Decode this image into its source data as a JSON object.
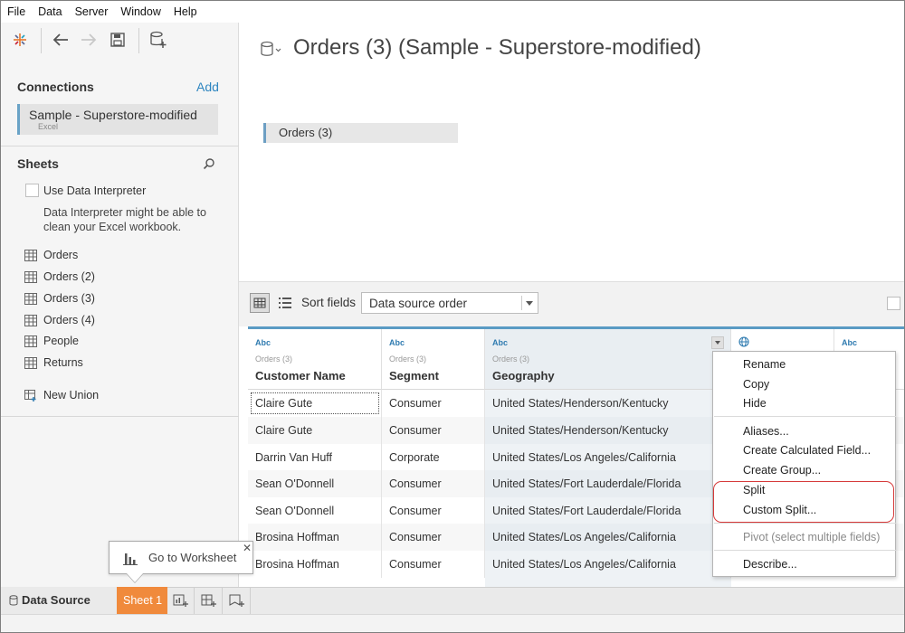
{
  "menubar": {
    "items": [
      "File",
      "Data",
      "Server",
      "Window",
      "Help"
    ]
  },
  "connections": {
    "title": "Connections",
    "add_label": "Add",
    "active": {
      "name": "Sample - Superstore-modified",
      "type": "Excel"
    }
  },
  "sheets": {
    "title": "Sheets",
    "interpreter_label": "Use Data Interpreter",
    "interpreter_note": "Data Interpreter might be able to clean your Excel workbook.",
    "items": [
      "Orders",
      "Orders (2)",
      "Orders (3)",
      "Orders (4)",
      "People",
      "Returns"
    ],
    "new_union_label": "New Union"
  },
  "canvas": {
    "title": "Orders (3) (Sample - Superstore-modified)",
    "table_name": "Orders (3)"
  },
  "grid_toolbar": {
    "sort_label": "Sort fields",
    "sort_value": "Data source order"
  },
  "grid": {
    "columns": [
      {
        "type": "Abc",
        "source": "Orders (3)",
        "name": "Customer Name"
      },
      {
        "type": "Abc",
        "source": "Orders (3)",
        "name": "Segment"
      },
      {
        "type": "Abc",
        "source": "Orders (3)",
        "name": "Geography"
      },
      {
        "type": "",
        "source": "",
        "name": ""
      },
      {
        "type": "Abc",
        "source": "",
        "name": ""
      }
    ],
    "rows": [
      [
        "Claire Gute",
        "Consumer",
        "United States/Henderson/Kentucky"
      ],
      [
        "Claire Gute",
        "Consumer",
        "United States/Henderson/Kentucky"
      ],
      [
        "Darrin Van Huff",
        "Corporate",
        "United States/Los Angeles/California"
      ],
      [
        "Sean O'Donnell",
        "Consumer",
        "United States/Fort Lauderdale/Florida"
      ],
      [
        "Sean O'Donnell",
        "Consumer",
        "United States/Fort Lauderdale/Florida"
      ],
      [
        "Brosina Hoffman",
        "Consumer",
        "United States/Los Angeles/California"
      ],
      [
        "Brosina Hoffman",
        "Consumer",
        "United States/Los Angeles/California"
      ]
    ]
  },
  "context_menu": {
    "items": [
      "Rename",
      "Copy",
      "Hide",
      "Aliases...",
      "Create Calculated Field...",
      "Create Group...",
      "Split",
      "Custom Split...",
      "Pivot (select multiple fields)",
      "Describe..."
    ]
  },
  "tooltip": {
    "text": "Go to Worksheet"
  },
  "tabs": {
    "data_source": "Data Source",
    "sheet": "Sheet 1"
  },
  "colors": {
    "accent": "#f08a3c",
    "link": "#2f86c0",
    "highlight": "#d63a3a",
    "selection": "#6aa3c7"
  }
}
